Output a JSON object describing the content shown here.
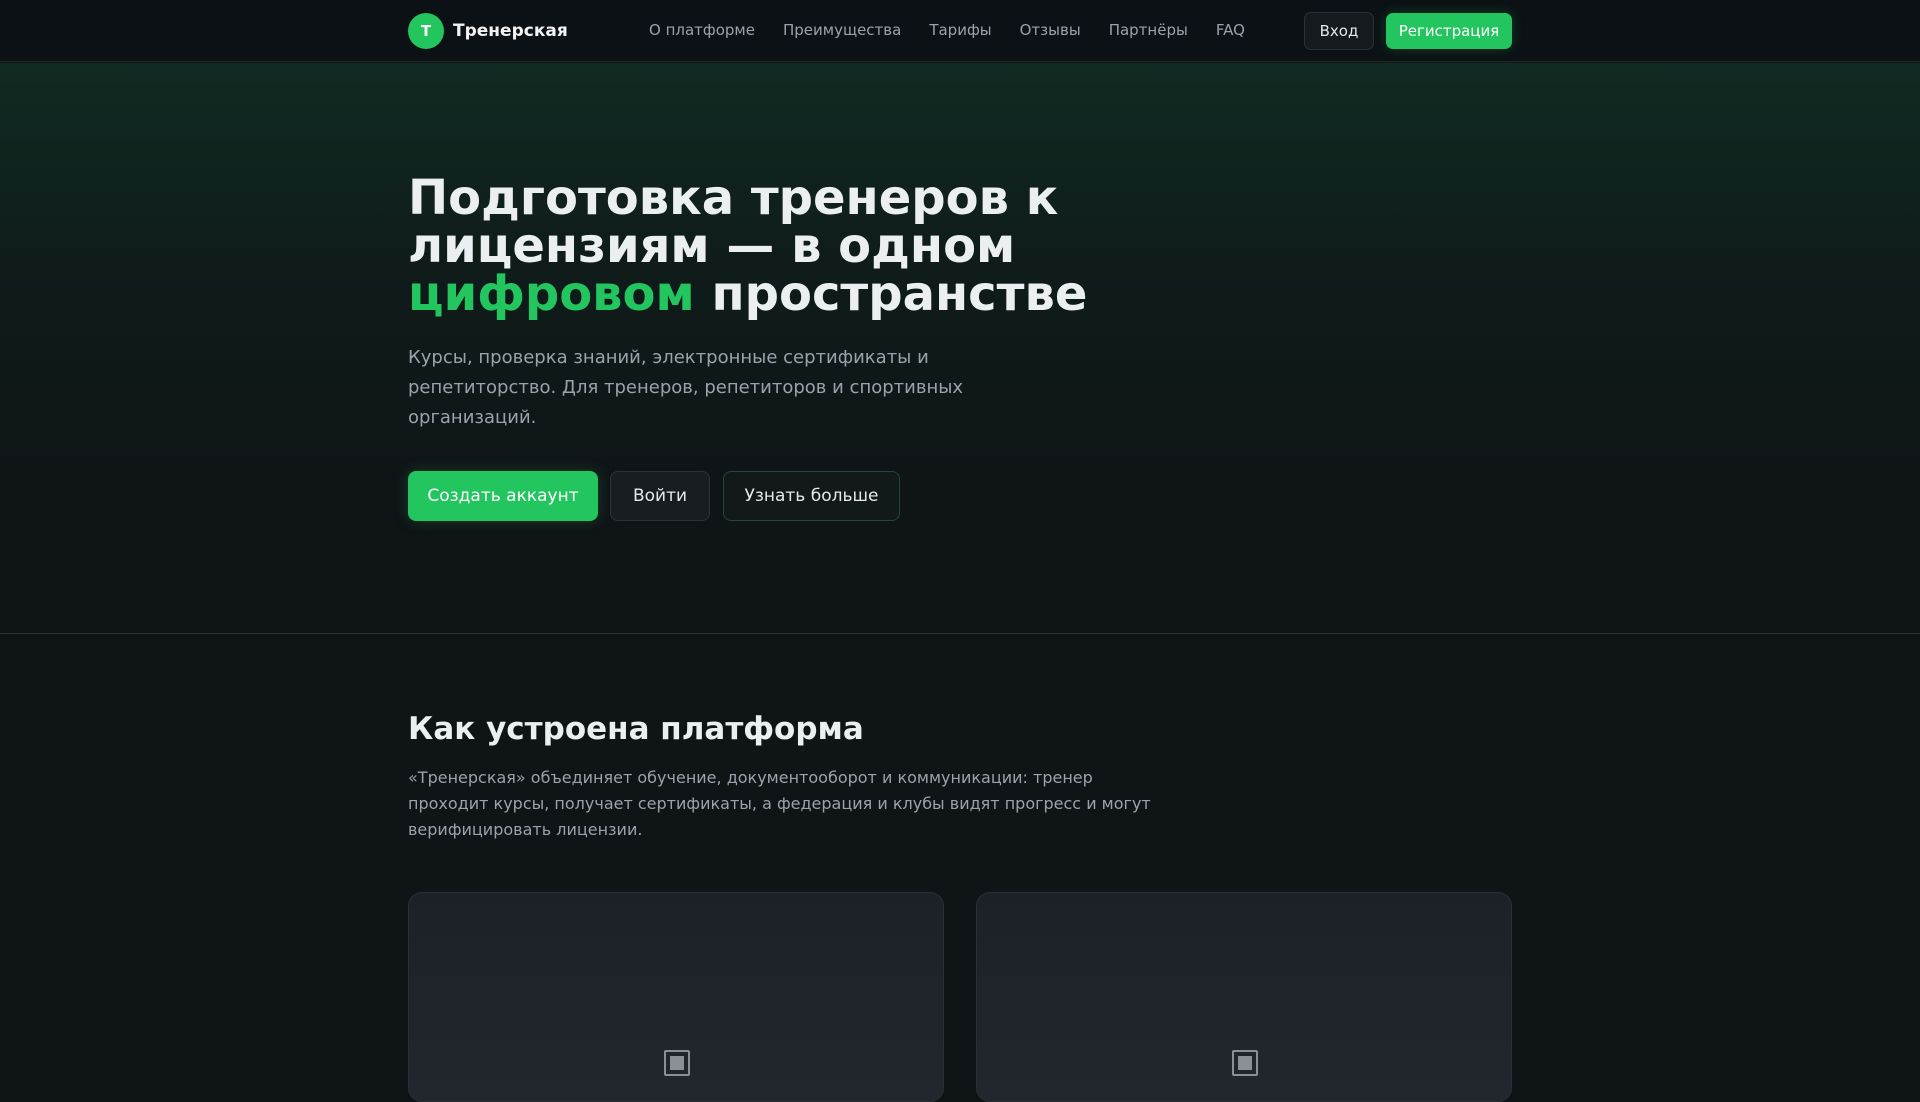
{
  "header": {
    "brand_mark": "Т",
    "brand_name": "Тренерская",
    "nav": [
      "О платформе",
      "Преимущества",
      "Тарифы",
      "Отзывы",
      "Партнёры",
      "FAQ"
    ],
    "login_label": "Вход",
    "register_label": "Регистрация"
  },
  "hero": {
    "title_part1": "Подготовка тренеров к лицензиям — в одном ",
    "title_accent": "цифровом",
    "title_part2": " пространстве",
    "subtitle": "Курсы, проверка знаний, электронные сертификаты и репетиторство. Для тренеров, репетиторов и спортивных организаций.",
    "primary_cta": "Создать аккаунт",
    "secondary_cta": "Войти",
    "outline_cta": "Узнать больше"
  },
  "section": {
    "title": "Как устроена платформа",
    "text": "«Тренерская» объединяет обучение, документооборот и коммуникации: тренер проходит курсы, получает сертификаты, а федерация и клубы видят прогресс и могут верифицировать лицензии."
  },
  "cards": [
    {
      "icon": "image-placeholder-icon"
    },
    {
      "icon": "image-placeholder-icon"
    }
  ],
  "colors": {
    "accent": "#22c55e",
    "background": "#0f1417",
    "muted_text": "#9aa3ab"
  }
}
